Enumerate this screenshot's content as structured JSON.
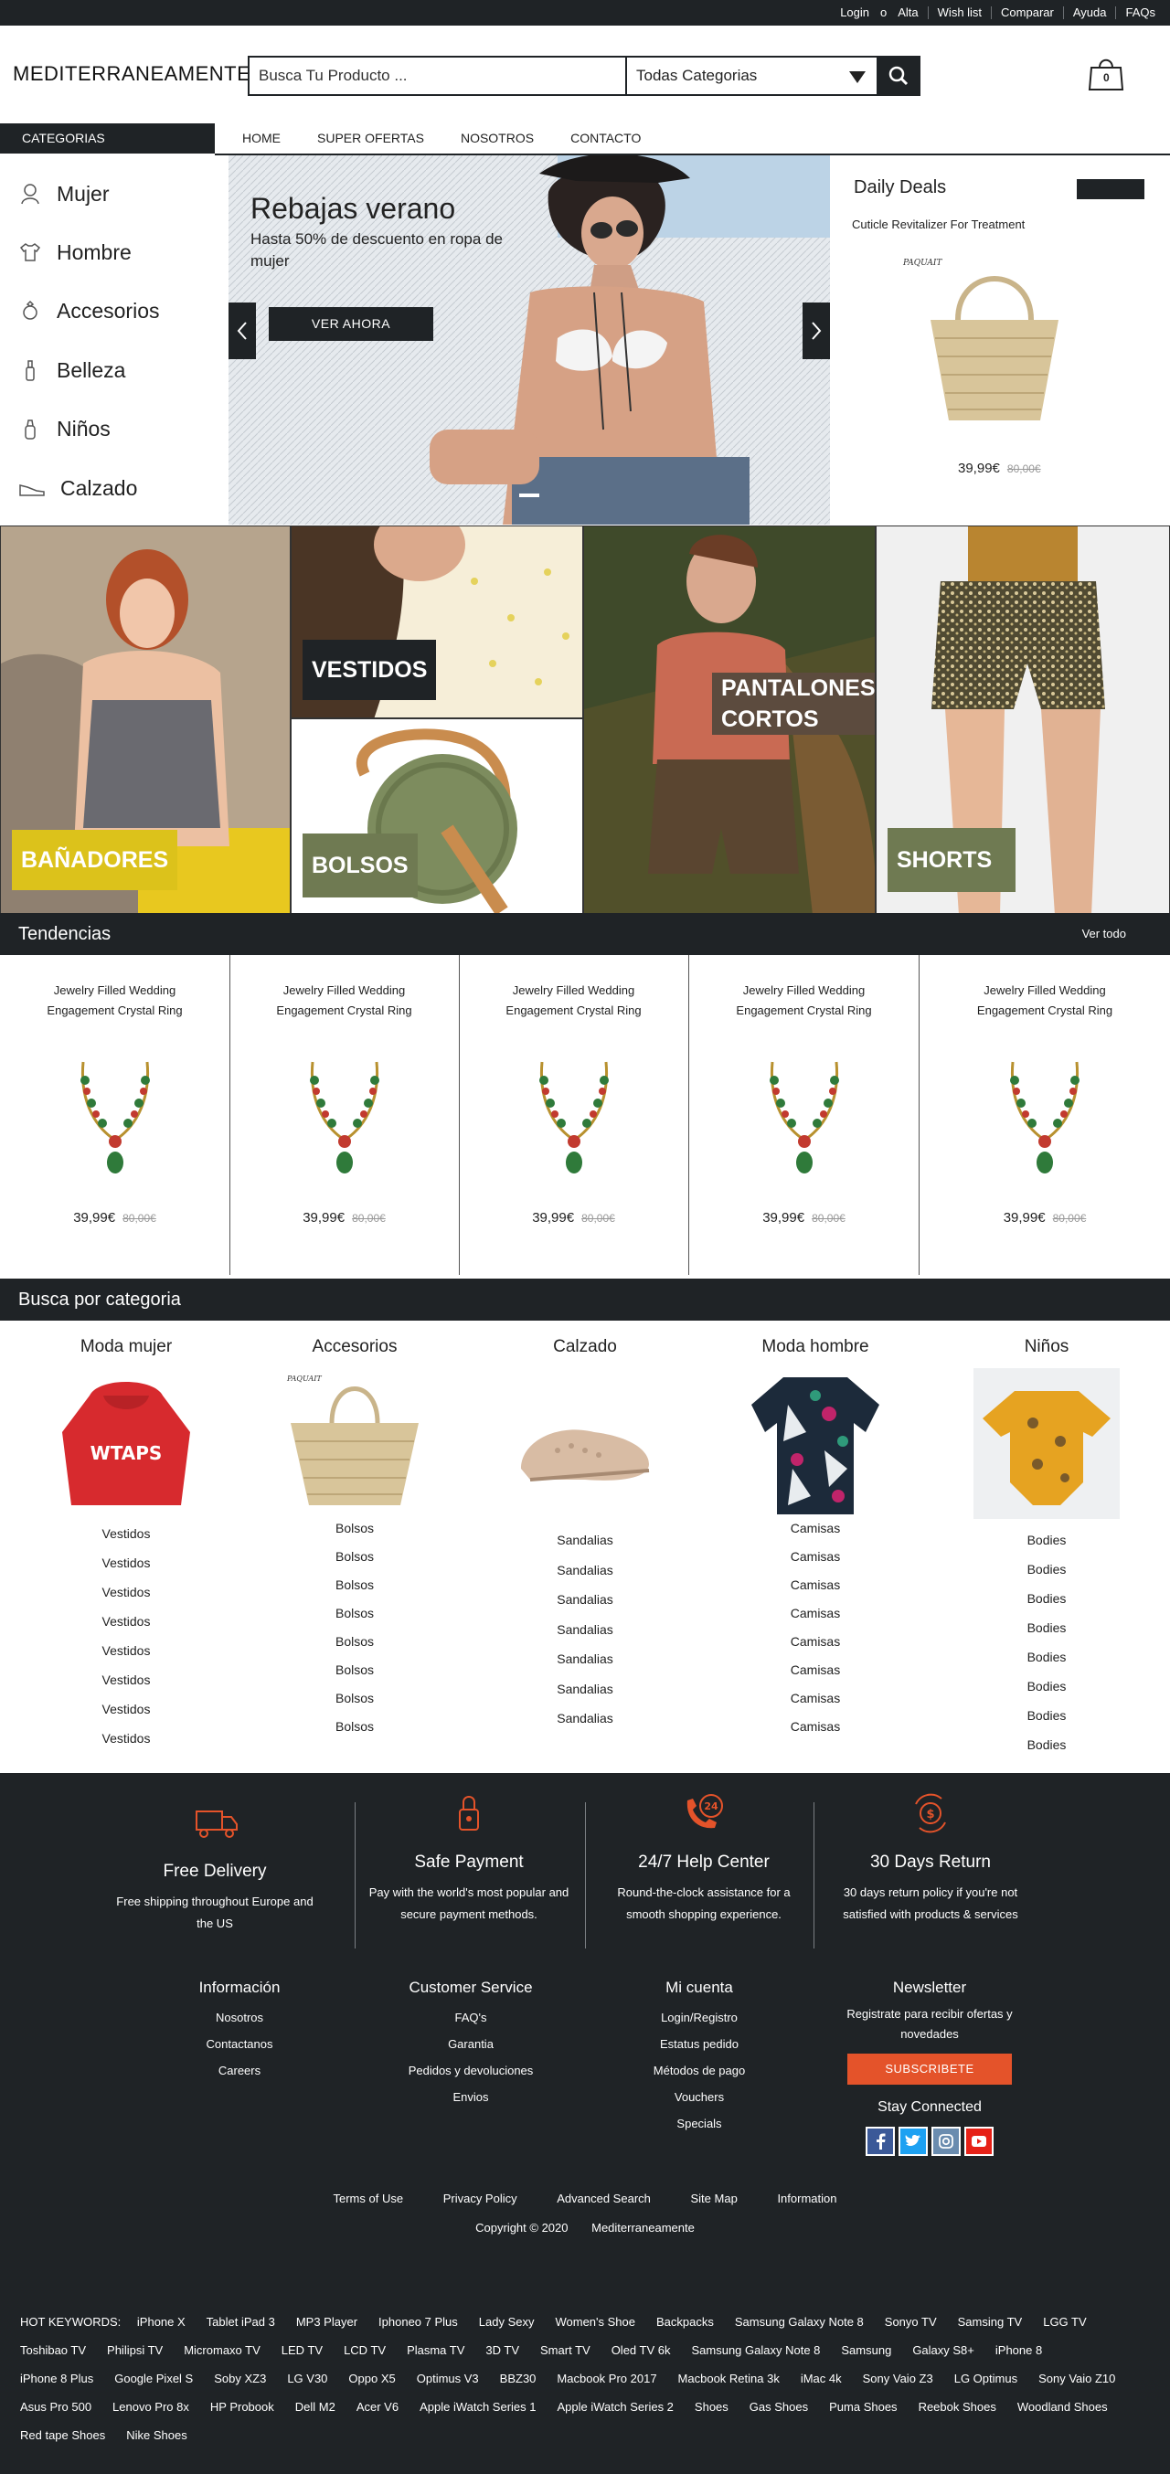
{
  "topbar": {
    "links": [
      "Login",
      "o",
      "Alta",
      "Wish list",
      "Comparar",
      "Ayuda",
      "FAQs"
    ]
  },
  "header": {
    "logo": "MEDITERRANEAMENTE",
    "search_placeholder": "Busca Tu Producto ...",
    "category_select": "Todas Categorias",
    "cart_count": "0"
  },
  "nav": {
    "categories_label": "CATEGORIAS",
    "items": [
      "HOME",
      "SUPER OFERTAS",
      "NOSOTROS",
      "CONTACTO"
    ]
  },
  "sidebar": {
    "items": [
      {
        "label": "Mujer",
        "icon": "woman-icon"
      },
      {
        "label": "Hombre",
        "icon": "shirt-icon"
      },
      {
        "label": "Accesorios",
        "icon": "ring-icon"
      },
      {
        "label": "Belleza",
        "icon": "bottle-icon"
      },
      {
        "label": "Niños",
        "icon": "baby-bottle-icon"
      },
      {
        "label": "Calzado",
        "icon": "shoe-icon"
      }
    ]
  },
  "hero": {
    "title": "Rebajas verano",
    "subtitle": "Hasta 50% de descuento en ropa de mujer",
    "cta": "VER AHORA"
  },
  "deals": {
    "title": "Daily Deals",
    "product": "Cuticle Revitalizer For Treatment",
    "brand_mark": "PAQUAIT",
    "price": "39,99€",
    "old_price": "80,00€"
  },
  "tiles": [
    "BAÑADORES",
    "VESTIDOS",
    "BOLSOS",
    "PANTALONES",
    "CORTOS",
    "SHORTS"
  ],
  "trends": {
    "title": "Tendencias",
    "view_all": "Ver todo",
    "products": [
      {
        "name": "Jewelry Filled Wedding Engagement Crystal Ring",
        "price": "39,99€",
        "old_price": "80,00€"
      },
      {
        "name": "Jewelry Filled Wedding Engagement Crystal Ring",
        "price": "39,99€",
        "old_price": "80,00€"
      },
      {
        "name": "Jewelry Filled Wedding Engagement Crystal Ring",
        "price": "39,99€",
        "old_price": "80,00€"
      },
      {
        "name": "Jewelry Filled Wedding Engagement Crystal Ring",
        "price": "39,99€",
        "old_price": "80,00€"
      },
      {
        "name": "Jewelry Filled Wedding Engagement Crystal Ring",
        "price": "39,99€",
        "old_price": "80,00€"
      }
    ]
  },
  "browse": {
    "title": "Busca por categoria",
    "columns": [
      {
        "title": "Moda mujer",
        "items": [
          "Vestidos",
          "Vestidos",
          "Vestidos",
          "Vestidos",
          "Vestidos",
          "Vestidos",
          "Vestidos",
          "Vestidos"
        ],
        "hoodie_text": "WTAPS"
      },
      {
        "title": "Accesorios",
        "items": [
          "Bolsos",
          "Bolsos",
          "Bolsos",
          "Bolsos",
          "Bolsos",
          "Bolsos",
          "Bolsos",
          "Bolsos"
        ],
        "brand_mark": "PAQUAIT"
      },
      {
        "title": "Calzado",
        "items": [
          "Sandalias",
          "Sandalias",
          "Sandalias",
          "Sandalias",
          "Sandalias",
          "Sandalias",
          "Sandalias"
        ]
      },
      {
        "title": "Moda hombre",
        "items": [
          "Camisas",
          "Camisas",
          "Camisas",
          "Camisas",
          "Camisas",
          "Camisas",
          "Camisas",
          "Camisas"
        ]
      },
      {
        "title": "Niños",
        "items": [
          "Bodies",
          "Bodies",
          "Bodies",
          "Bodies",
          "Bodies",
          "Bodies",
          "Bodies",
          "Bodies"
        ]
      }
    ]
  },
  "features": [
    {
      "title": "Free Delivery",
      "desc": "Free shipping throughout Europe and the US"
    },
    {
      "title": "Safe Payment",
      "desc": "Pay with the world's most popular and secure payment methods."
    },
    {
      "title": "24/7 Help Center",
      "desc": "Round-the-clock assistance for a smooth shopping experience.",
      "icon_text": "24"
    },
    {
      "title": "30 Days Return",
      "desc": "30 days return policy if you're not satisfied with products & services",
      "icon_text": "$"
    }
  ],
  "footer_cols": {
    "info": {
      "title": "Información",
      "items": [
        "Nosotros",
        "Contactanos",
        "Careers"
      ]
    },
    "service": {
      "title": "Customer Service",
      "items": [
        "FAQ's",
        "Garantia",
        "Pedidos y devoluciones",
        "Envios"
      ]
    },
    "account": {
      "title": "Mi cuenta",
      "items": [
        "Login/Registro",
        "Estatus pedido",
        "Métodos de pago",
        "Vouchers",
        "Specials"
      ]
    },
    "newsletter": {
      "title": "Newsletter",
      "text": "Registrate para recibir ofertas y novedades",
      "button": "SUBSCRIBETE",
      "stay": "Stay Connected"
    }
  },
  "bottom_links": [
    "Terms of Use",
    "Privacy Policy",
    "Advanced Search",
    "Site Map",
    "Information"
  ],
  "copyright": {
    "text": "Copyright © 2020",
    "brand": "Mediterraneamente"
  },
  "hot_keywords": {
    "label": "HOT KEYWORDS:",
    "items": [
      "iPhone X",
      "Tablet iPad 3",
      "MP3 Player",
      "Iphoneo 7 Plus",
      "Lady Sexy",
      "Women's Shoe",
      "Backpacks",
      "Samsung Galaxy Note 8",
      "Sonyo TV",
      "Samsing TV",
      "LGG TV",
      "Toshibao TV",
      "Philipsi TV",
      "Micromaxo TV",
      "LED TV",
      "LCD TV",
      "Plasma TV",
      "3D TV",
      "Smart TV",
      "Oled TV 6k",
      "Samsung Galaxy Note 8",
      "Samsung",
      "Galaxy S8+",
      "iPhone 8",
      "iPhone 8 Plus",
      "Google Pixel S",
      "Soby XZ3",
      "LG V30",
      "Oppo X5",
      "Optimus V3",
      "BBZ30",
      "Macbook Pro 2017",
      "Macbook Retina 3k",
      "iMac 4k",
      "Sony Vaio Z3",
      "LG Optimus",
      "Sony Vaio Z10",
      "Asus Pro 500",
      "Lenovo Pro 8x",
      "HP Probook",
      "Dell M2",
      "Acer V6",
      "Apple iWatch Series 1",
      "Apple iWatch Series 2",
      "Shoes",
      "Gas Shoes",
      "Puma Shoes",
      "Reebok Shoes",
      "Woodland Shoes",
      "Red tape Shoes",
      "Nike Shoes"
    ]
  },
  "colors": {
    "dark": "#1f2326",
    "accent": "#e4532a",
    "tile_green": "#6f7a52",
    "tile_yellow": "#dcc21b"
  }
}
